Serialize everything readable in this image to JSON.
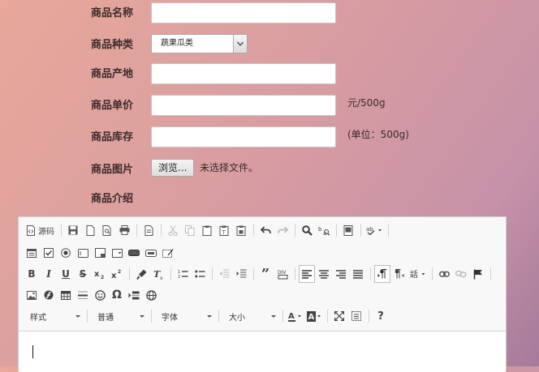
{
  "form": {
    "name": {
      "label": "商品名称",
      "value": ""
    },
    "category": {
      "label": "商品种类",
      "selected": "蔬果瓜类"
    },
    "origin": {
      "label": "商品产地",
      "value": ""
    },
    "price": {
      "label": "商品单价",
      "value": "",
      "unit": "元/500g"
    },
    "stock": {
      "label": "商品库存",
      "value": "",
      "unit": "(单位：500g)"
    },
    "image": {
      "label": "商品图片",
      "button": "浏览...",
      "status": "未选择文件。"
    },
    "intro": {
      "label": "商品介绍"
    }
  },
  "editor": {
    "source_label": "源码",
    "format_combos": [
      {
        "label": "样式"
      },
      {
        "label": "普通"
      },
      {
        "label": "字体"
      },
      {
        "label": "大小"
      }
    ],
    "content": ""
  }
}
